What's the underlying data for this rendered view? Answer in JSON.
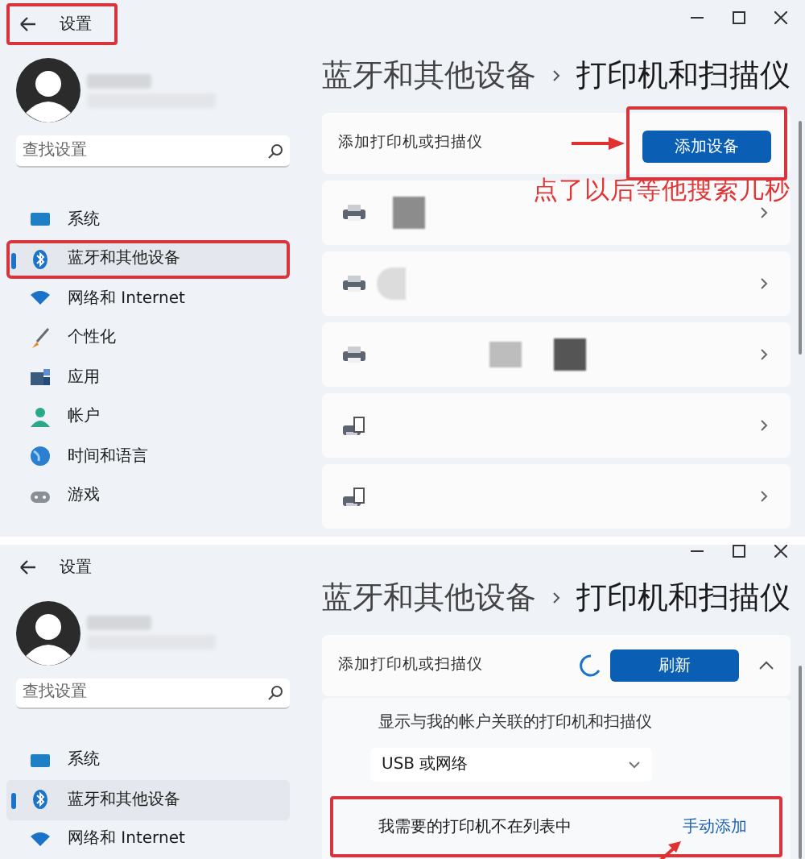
{
  "screens": [
    {
      "window": {
        "title": "设置",
        "highlighted": true
      },
      "sidebar": {
        "search": {
          "placeholder": "查找设置"
        },
        "items": [
          {
            "kind": "system",
            "label": "系统",
            "selected": false,
            "highlighted": false
          },
          {
            "kind": "bluetooth",
            "label": "蓝牙和其他设备",
            "selected": true,
            "highlighted": true
          },
          {
            "kind": "network",
            "label": "网络和 Internet",
            "selected": false,
            "highlighted": false
          },
          {
            "kind": "personalize",
            "label": "个性化",
            "selected": false,
            "highlighted": false
          },
          {
            "kind": "apps",
            "label": "应用",
            "selected": false,
            "highlighted": false
          },
          {
            "kind": "account",
            "label": "帐户",
            "selected": false,
            "highlighted": false
          },
          {
            "kind": "time",
            "label": "时间和语言",
            "selected": false,
            "highlighted": false
          },
          {
            "kind": "gaming",
            "label": "游戏",
            "selected": false,
            "highlighted": false
          }
        ]
      },
      "breadcrumb": [
        "蓝牙和其他设备",
        "打印机和扫描仪"
      ],
      "add_card": {
        "label": "添加打印机或扫描仪",
        "button": "添加设备",
        "button_highlighted": true,
        "searching": false,
        "expanded": false
      },
      "callout": "点了以后等他搜索几秒",
      "printers": [
        {
          "kind": "printer"
        },
        {
          "kind": "printer"
        },
        {
          "kind": "printer"
        },
        {
          "kind": "document-printer"
        },
        {
          "kind": "document-printer"
        }
      ]
    },
    {
      "window": {
        "title": "设置",
        "highlighted": false
      },
      "sidebar": {
        "search": {
          "placeholder": "查找设置"
        },
        "items": [
          {
            "kind": "system",
            "label": "系统",
            "selected": false,
            "highlighted": false
          },
          {
            "kind": "bluetooth",
            "label": "蓝牙和其他设备",
            "selected": true,
            "highlighted": false
          },
          {
            "kind": "network",
            "label": "网络和 Internet",
            "selected": false,
            "highlighted": false
          }
        ]
      },
      "breadcrumb": [
        "蓝牙和其他设备",
        "打印机和扫描仪"
      ],
      "add_card": {
        "label": "添加打印机或扫描仪",
        "button": "刷新",
        "button_highlighted": false,
        "searching": true,
        "expanded": true
      },
      "options": {
        "text": "显示与我的帐户关联的打印机和扫描仪",
        "dropdown": "USB 或网络",
        "missing": {
          "label": "我需要的打印机不在列表中",
          "link": "手动添加",
          "highlighted": true
        }
      }
    }
  ]
}
